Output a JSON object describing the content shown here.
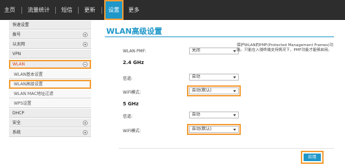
{
  "nav": {
    "items": [
      "主页",
      "流量统计",
      "短信",
      "更新",
      "设置",
      "更多"
    ],
    "active_index": 4
  },
  "sidebar": {
    "items": [
      {
        "label": "快速设置"
      },
      {
        "label": "拨号"
      },
      {
        "label": "以太网"
      },
      {
        "label": "VPN"
      },
      {
        "label": "WLAN"
      },
      {
        "label": "WLAN基本设置"
      },
      {
        "label": "WLAN高级设置"
      },
      {
        "label": "WLAN MAC地址过滤"
      },
      {
        "label": "WPS设置"
      },
      {
        "label": "DHCP"
      },
      {
        "label": "安全"
      },
      {
        "label": "系统"
      }
    ]
  },
  "main": {
    "title": "WLAN高级设置",
    "pmf": {
      "label": "WLAN PMF:",
      "value": "关闭",
      "note": "保护WLAN的PMF(Protected Management Frames)功能。只能在入侵终端支持情况下，PMF功能才能够启用。"
    },
    "band24": {
      "header": "2.4 GHz",
      "channel_label": "信道:",
      "channel_value": "自动",
      "mode_label": "WiFi模式:",
      "mode_value": "自动(默认)"
    },
    "band5": {
      "header": "5 GHz",
      "channel_label": "信道:",
      "channel_value": "自动",
      "mode_label": "WiFi模式:",
      "mode_value": "自动(默认)"
    },
    "apply_label": "应用"
  },
  "colors": {
    "accent": "#1f97c9",
    "highlight": "#f39c34",
    "nav_bg": "#2d2d2d"
  }
}
